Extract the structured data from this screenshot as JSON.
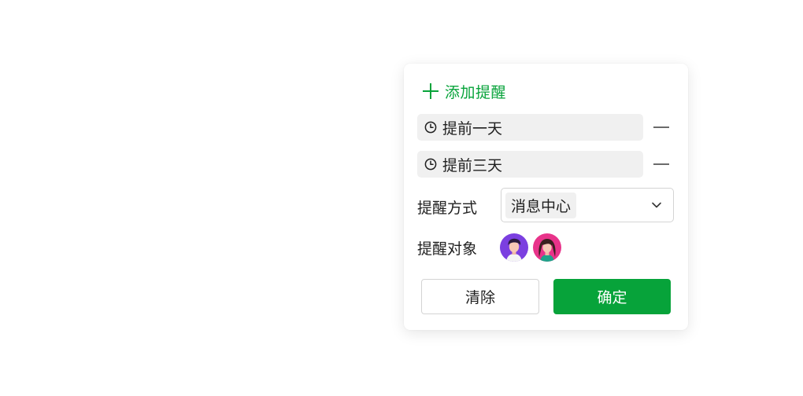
{
  "add_reminder": {
    "label": "添加提醒",
    "icon": "plus-icon",
    "color": "#07a33a"
  },
  "reminders": [
    {
      "label": "提前一天",
      "icon": "clock-icon",
      "remove_icon": "minus-icon"
    },
    {
      "label": "提前三天",
      "icon": "clock-icon",
      "remove_icon": "minus-icon"
    }
  ],
  "method": {
    "label": "提醒方式",
    "selected": "消息中心",
    "icon": "chevron-down-icon"
  },
  "targets": {
    "label": "提醒对象",
    "avatars": [
      {
        "name": "avatar-man",
        "bg": "#7b3fe0"
      },
      {
        "name": "avatar-woman",
        "bg": "#e8338a"
      }
    ]
  },
  "buttons": {
    "clear": "清除",
    "confirm": "确定"
  },
  "colors": {
    "accent": "#07a33a",
    "chip_bg": "#f0f0f0",
    "border": "#d4d4d4"
  }
}
